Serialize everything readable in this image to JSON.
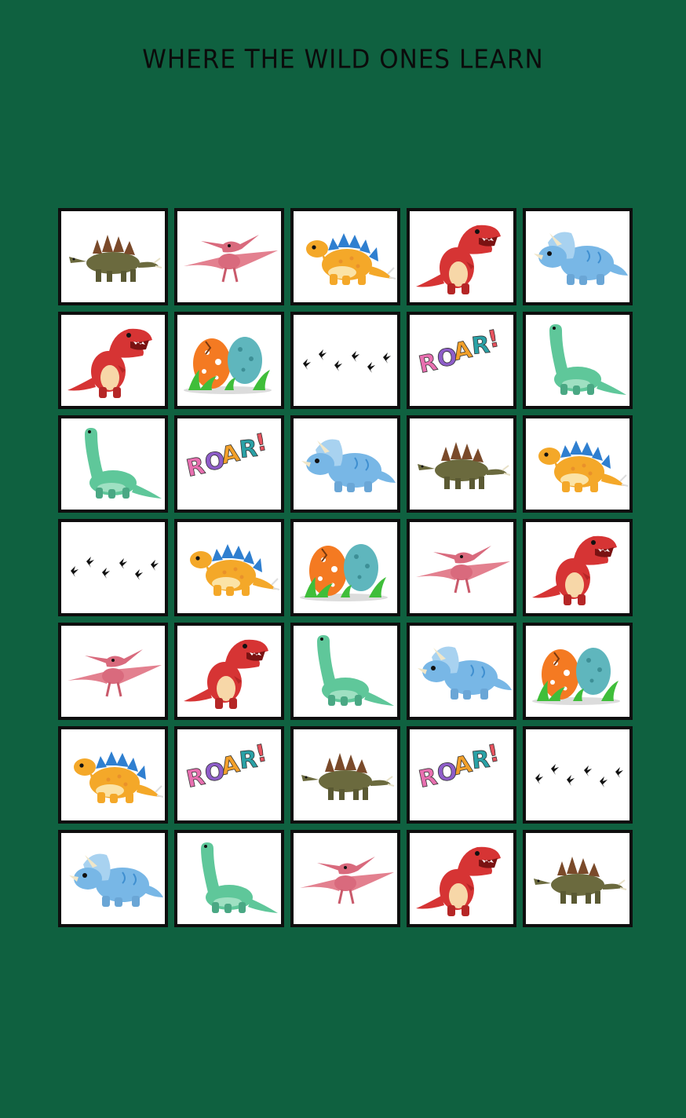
{
  "header": {
    "title": "WHERE THE WILD ONES LEARN"
  },
  "board": {
    "rows": 7,
    "cols": 5,
    "cards": [
      "stegosaurus",
      "pterodactyl",
      "yellow-stegosaurus",
      "t-rex",
      "triceratops",
      "t-rex",
      "dino-eggs",
      "footprints",
      "roar-text",
      "brachiosaurus",
      "brachiosaurus",
      "roar-text",
      "triceratops",
      "stegosaurus",
      "yellow-stegosaurus",
      "footprints",
      "yellow-stegosaurus",
      "dino-eggs",
      "pterodactyl",
      "t-rex",
      "pterodactyl",
      "t-rex",
      "brachiosaurus",
      "triceratops",
      "dino-eggs",
      "yellow-stegosaurus",
      "roar-text",
      "stegosaurus",
      "roar-text",
      "footprints",
      "triceratops",
      "brachiosaurus",
      "pterodactyl",
      "t-rex",
      "stegosaurus"
    ],
    "roar_label": "ROAR!"
  }
}
